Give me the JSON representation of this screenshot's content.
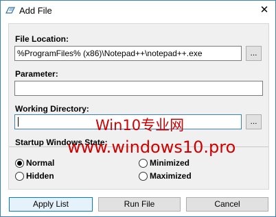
{
  "window": {
    "title": "Add File",
    "icon": "notepad-pencil-icon",
    "close_glyph": "✕"
  },
  "form": {
    "file_location": {
      "label": "File Location:",
      "value": "%ProgramFiles% (x86)\\Notepad++\\notepad++.exe",
      "browse_label": "..."
    },
    "parameter": {
      "label": "Parameter:",
      "value": ""
    },
    "working_directory": {
      "label": "Working Directory:",
      "value": "",
      "browse_label": "..."
    },
    "startup_state": {
      "label": "Startup Windows State:",
      "options": [
        {
          "label": "Normal",
          "checked": true
        },
        {
          "label": "Minimized",
          "checked": false
        },
        {
          "label": "Hidden",
          "checked": false
        },
        {
          "label": "Maximized",
          "checked": false
        }
      ]
    }
  },
  "buttons": {
    "apply_list": "Apply List",
    "run_file": "Run File",
    "cancel": "Cancel"
  },
  "watermark": {
    "line1": "Win10专业网",
    "line2": "www.windows10.pro"
  },
  "colors": {
    "accent": "#3c7fb1",
    "watermark": "#d00000",
    "panel": "#f0f0f0"
  }
}
